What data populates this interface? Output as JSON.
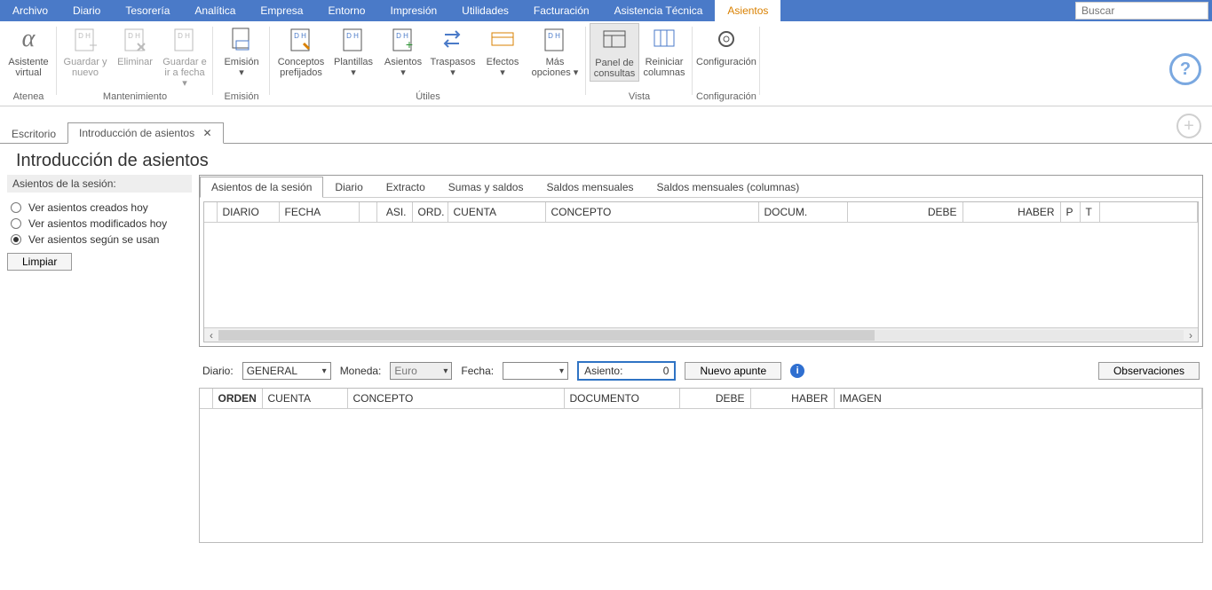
{
  "menubar": {
    "items": [
      "Archivo",
      "Diario",
      "Tesorería",
      "Analítica",
      "Empresa",
      "Entorno",
      "Impresión",
      "Utilidades",
      "Facturación",
      "Asistencia Técnica",
      "Asientos"
    ],
    "active_index": 10,
    "search_placeholder": "Buscar"
  },
  "ribbon": {
    "groups": [
      {
        "label": "Atenea",
        "buttons": [
          {
            "label": "Asistente virtual",
            "icon": "alpha"
          }
        ]
      },
      {
        "label": "Mantenimiento",
        "buttons": [
          {
            "label": "Guardar y nuevo",
            "icon": "save-new",
            "disabled": true
          },
          {
            "label": "Eliminar",
            "icon": "delete",
            "disabled": true
          },
          {
            "label": "Guardar e ir a fecha",
            "icon": "save-goto",
            "disabled": true,
            "caret": true
          }
        ]
      },
      {
        "label": "Emisión",
        "buttons": [
          {
            "label": "Emisión",
            "icon": "emit",
            "caret": true
          }
        ]
      },
      {
        "label": "Útiles",
        "buttons": [
          {
            "label": "Conceptos prefijados",
            "icon": "concepts"
          },
          {
            "label": "Plantillas",
            "icon": "templates",
            "caret": true
          },
          {
            "label": "Asientos",
            "icon": "asientos",
            "caret": true
          },
          {
            "label": "Traspasos",
            "icon": "traspasos",
            "caret": true
          },
          {
            "label": "Efectos",
            "icon": "efectos",
            "caret": true
          },
          {
            "label": "Más opciones",
            "icon": "more",
            "caret": true
          }
        ]
      },
      {
        "label": "Vista",
        "buttons": [
          {
            "label": "Panel de consultas",
            "icon": "panel",
            "active": true
          },
          {
            "label": "Reiniciar columnas",
            "icon": "reset-cols"
          }
        ]
      },
      {
        "label": "Configuración",
        "buttons": [
          {
            "label": "Configuración",
            "icon": "gear"
          }
        ]
      }
    ]
  },
  "tabstrip": {
    "tabs": [
      {
        "label": "Escritorio",
        "active": false,
        "closable": false
      },
      {
        "label": "Introducción de asientos",
        "active": true,
        "closable": true
      }
    ]
  },
  "page_title": "Introducción de asientos",
  "side": {
    "header": "Asientos de la sesión:",
    "radios": [
      {
        "label": "Ver asientos creados hoy",
        "checked": false
      },
      {
        "label": "Ver asientos modificados hoy",
        "checked": false
      },
      {
        "label": "Ver asientos según se usan",
        "checked": true
      }
    ],
    "clear_btn": "Limpiar"
  },
  "subtabs": [
    "Asientos de la sesión",
    "Diario",
    "Extracto",
    "Sumas y saldos",
    "Saldos mensuales",
    "Saldos mensuales (columnas)"
  ],
  "subtab_active": 0,
  "grid_top_headers": [
    "DIARIO",
    "FECHA",
    "",
    "ASI.",
    "ORD.",
    "CUENTA",
    "CONCEPTO",
    "DOCUM.",
    "DEBE",
    "HABER",
    "P",
    "T",
    ""
  ],
  "form": {
    "diario_label": "Diario:",
    "diario_value": "GENERAL",
    "moneda_label": "Moneda:",
    "moneda_value": "Euro",
    "fecha_label": "Fecha:",
    "fecha_value": "",
    "asiento_label": "Asiento:",
    "asiento_value": "0",
    "nuevo_btn": "Nuevo apunte",
    "obs_btn": "Observaciones"
  },
  "grid_bottom_headers": [
    "ORDEN",
    "CUENTA",
    "CONCEPTO",
    "DOCUMENTO",
    "DEBE",
    "HABER",
    "IMAGEN"
  ]
}
